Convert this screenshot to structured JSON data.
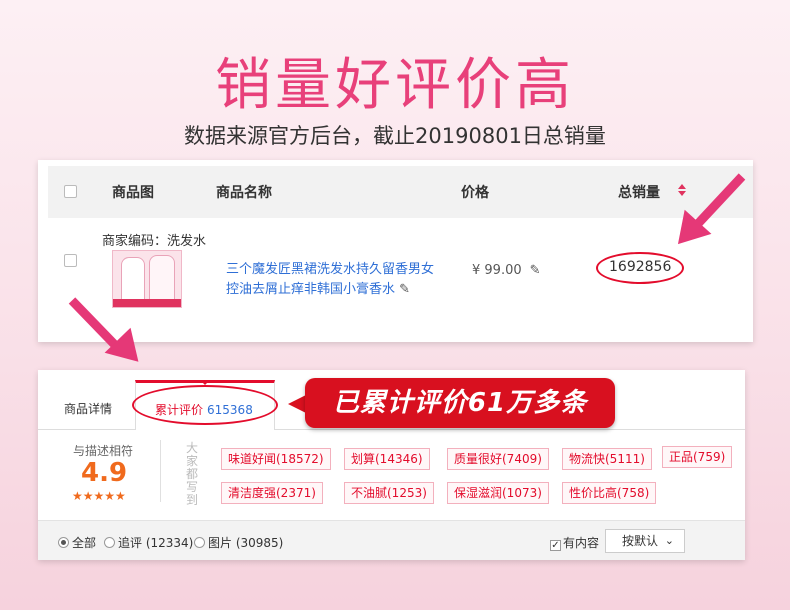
{
  "headline": "销量好评价高",
  "subline": "数据来源官方后台，截止20190801日总销量",
  "table": {
    "headers": {
      "image": "商品图",
      "name": "商品名称",
      "price": "价格",
      "sales": "总销量"
    },
    "row": {
      "merchant_code": "商家编码：洗发水",
      "product_name": "三个魔发匠黑裙洗发水持久留香男女控油去屑止痒非韩国小膏香水",
      "price": "¥ 99.00",
      "total_sales": "1692856"
    }
  },
  "reviews": {
    "tabs": {
      "details": "商品详情",
      "reviews_label": "累计评价",
      "reviews_count": "615368"
    },
    "banner": "已累计评价61万多条",
    "rating": {
      "label": "与描述相符",
      "score": "4.9",
      "stars": "★★★★★"
    },
    "vertical_text": "大家都写到",
    "tags": [
      "味道好闻(18572)",
      "划算(14346)",
      "质量很好(7409)",
      "物流快(5111)",
      "正品(759)",
      "清洁度强(2371)",
      "不油腻(1253)",
      "保湿滋润(1073)",
      "性价比高(758)"
    ],
    "filters": {
      "all": "全部",
      "followup": "追评 (12334)",
      "photos": "图片 (30985)",
      "has_content": "有内容",
      "sort": "按默认"
    }
  },
  "colors": {
    "headline": "#e8407a",
    "accent_red": "#e30c2c",
    "link_blue": "#2f6fd6",
    "rating_orange": "#f06a1d",
    "arrow_pink": "#e53877"
  }
}
